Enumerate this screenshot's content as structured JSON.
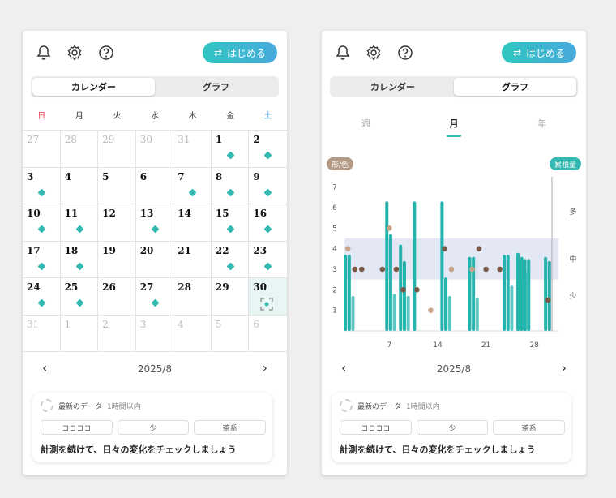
{
  "colors": {
    "accent": "#33b8b2",
    "accent2": "#48a9dc",
    "sunday": "#e0454c",
    "saturday": "#3a9ee0",
    "dot_brown": "#7a5a48",
    "dot_tan": "#c9a48a",
    "band": "#e3e8f4"
  },
  "start_button": {
    "icon": "swap-arrows-icon",
    "label": "はじめる"
  },
  "header_icons": [
    "bell-icon",
    "gear-icon",
    "help-icon"
  ],
  "tabs": {
    "calendar": "カレンダー",
    "graph": "グラフ"
  },
  "weekdays": [
    "日",
    "月",
    "火",
    "水",
    "木",
    "金",
    "土"
  ],
  "calendar_cells": [
    {
      "d": "27",
      "o": true,
      "dot": false
    },
    {
      "d": "28",
      "o": true,
      "dot": false
    },
    {
      "d": "29",
      "o": true,
      "dot": false
    },
    {
      "d": "30",
      "o": true,
      "dot": false
    },
    {
      "d": "31",
      "o": true,
      "dot": false
    },
    {
      "d": "1",
      "o": false,
      "dot": true
    },
    {
      "d": "2",
      "o": false,
      "dot": true
    },
    {
      "d": "3",
      "o": false,
      "dot": true
    },
    {
      "d": "4",
      "o": false,
      "dot": false
    },
    {
      "d": "5",
      "o": false,
      "dot": false
    },
    {
      "d": "6",
      "o": false,
      "dot": false
    },
    {
      "d": "7",
      "o": false,
      "dot": true
    },
    {
      "d": "8",
      "o": false,
      "dot": true
    },
    {
      "d": "9",
      "o": false,
      "dot": true
    },
    {
      "d": "10",
      "o": false,
      "dot": true
    },
    {
      "d": "11",
      "o": false,
      "dot": true
    },
    {
      "d": "12",
      "o": false,
      "dot": false
    },
    {
      "d": "13",
      "o": false,
      "dot": true
    },
    {
      "d": "14",
      "o": false,
      "dot": false
    },
    {
      "d": "15",
      "o": false,
      "dot": true
    },
    {
      "d": "16",
      "o": false,
      "dot": true
    },
    {
      "d": "17",
      "o": false,
      "dot": true
    },
    {
      "d": "18",
      "o": false,
      "dot": true
    },
    {
      "d": "19",
      "o": false,
      "dot": false
    },
    {
      "d": "20",
      "o": false,
      "dot": false
    },
    {
      "d": "21",
      "o": false,
      "dot": false
    },
    {
      "d": "22",
      "o": false,
      "dot": true
    },
    {
      "d": "23",
      "o": false,
      "dot": true
    },
    {
      "d": "24",
      "o": false,
      "dot": true
    },
    {
      "d": "25",
      "o": false,
      "dot": true
    },
    {
      "d": "26",
      "o": false,
      "dot": false
    },
    {
      "d": "27",
      "o": false,
      "dot": true
    },
    {
      "d": "28",
      "o": false,
      "dot": false
    },
    {
      "d": "29",
      "o": false,
      "dot": false
    },
    {
      "d": "30",
      "o": false,
      "dot": false,
      "today": true
    },
    {
      "d": "31",
      "o": true,
      "dot": false
    },
    {
      "d": "1",
      "o": true,
      "dot": false
    },
    {
      "d": "2",
      "o": true,
      "dot": false
    },
    {
      "d": "3",
      "o": true,
      "dot": false
    },
    {
      "d": "4",
      "o": true,
      "dot": false
    },
    {
      "d": "5",
      "o": true,
      "dot": false
    },
    {
      "d": "6",
      "o": true,
      "dot": false
    }
  ],
  "month_nav": {
    "prev": "‹",
    "label": "2025/8",
    "next": "›"
  },
  "latest_card": {
    "title": "最新のデータ",
    "subtitle": "1時間以内",
    "chips": [
      "ココココ",
      "少",
      "茶系"
    ],
    "message": "計測を続けて、日々の変化をチェックしましょう"
  },
  "period_tabs": [
    "週",
    "月",
    "年"
  ],
  "chart_data": {
    "type": "bar",
    "left_axis_badge": "形/色",
    "right_axis_badge": "累積量",
    "y_ticks": [
      "1",
      "2",
      "3",
      "4",
      "5",
      "6",
      "7"
    ],
    "right_labels": [
      "少",
      "中",
      "多"
    ],
    "x_ticks": [
      "7",
      "14",
      "21",
      "28"
    ],
    "ylim": [
      0,
      7.5
    ],
    "x": [
      1,
      2,
      3,
      4,
      5,
      6,
      7,
      8,
      9,
      10,
      11,
      12,
      13,
      14,
      15,
      16,
      17,
      18,
      19,
      20,
      21,
      22,
      23,
      24,
      25,
      26,
      27,
      28,
      29,
      30,
      31
    ],
    "bars": [
      [
        3.7,
        3.7,
        1.7
      ],
      [
        0,
        0,
        0
      ],
      [
        0,
        0,
        0
      ],
      [
        6.3,
        4.7,
        1.8
      ],
      [
        4.2,
        3.4,
        1.7
      ],
      [
        6.3,
        0,
        0
      ],
      [
        0,
        0,
        0
      ],
      [
        6.3,
        2.6,
        1.7
      ],
      [
        0,
        0,
        0
      ],
      [
        3.6,
        3.6,
        1.6
      ],
      [
        0,
        0,
        0
      ],
      [
        0,
        0,
        0
      ],
      [
        0,
        0,
        0
      ],
      [
        3.7,
        3.7,
        2.2
      ],
      [
        0,
        0,
        0
      ],
      [
        3.8,
        3.6,
        2.9
      ],
      [
        3.5,
        3.5,
        0
      ],
      [
        0,
        0,
        0
      ],
      [
        3.6,
        3.4,
        0
      ]
    ],
    "shape_points": [
      4,
      3,
      3,
      0,
      0,
      3,
      5,
      3,
      2,
      0,
      2,
      0,
      1,
      0,
      4,
      3,
      0,
      0,
      3,
      4,
      3,
      0,
      3,
      0,
      0,
      0,
      0,
      0,
      0,
      1.5,
      0
    ],
    "band": [
      2.5,
      4.5
    ]
  }
}
